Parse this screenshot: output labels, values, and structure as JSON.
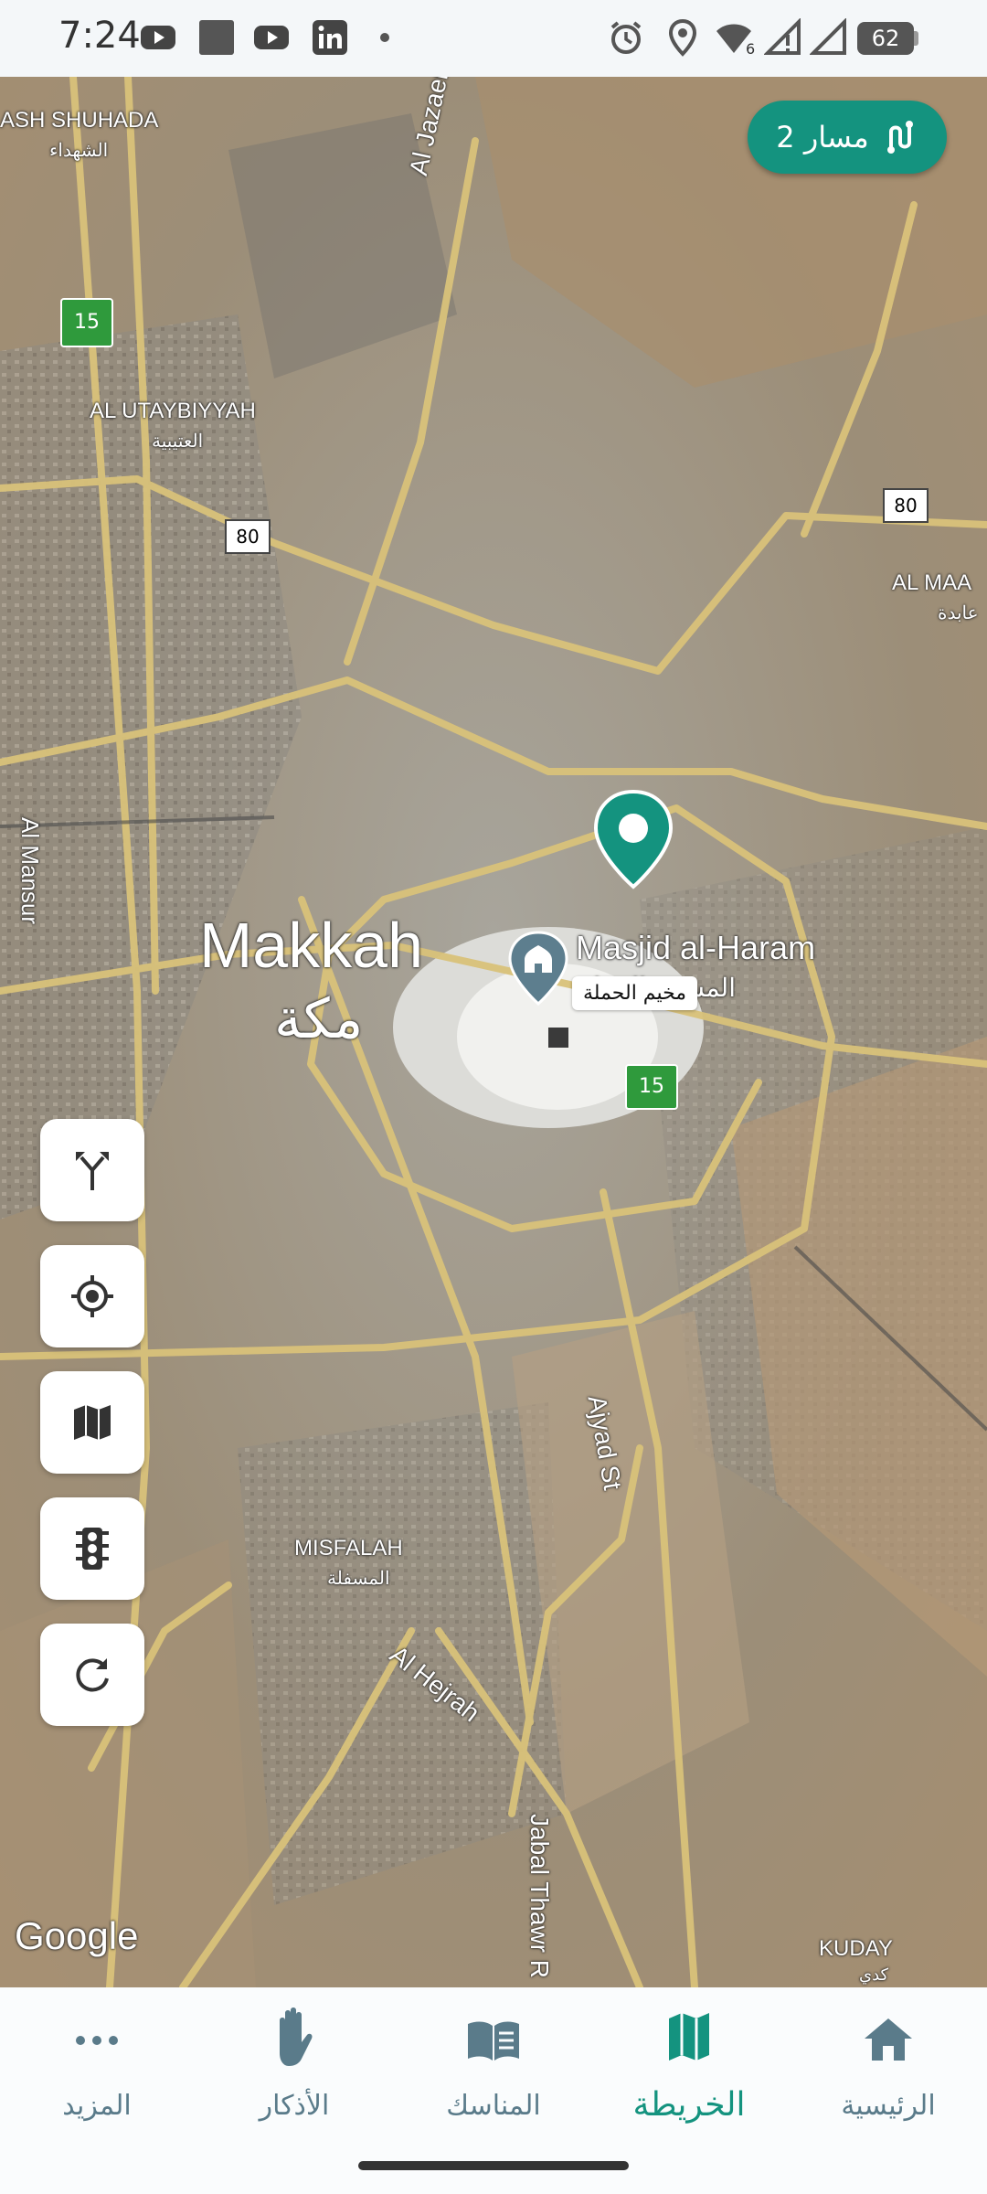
{
  "status_bar": {
    "time": "7:24",
    "battery": "62",
    "signal_badge": "6",
    "left_icons": [
      "youtube-icon",
      "app-square-icon",
      "youtube-icon",
      "linkedin-icon",
      "dot-icon"
    ],
    "right_icons": [
      "alarm-icon",
      "location-icon",
      "wifi-icon",
      "signal-icon",
      "signal-icon",
      "battery-icon"
    ]
  },
  "route_button": {
    "label": "2 مسار",
    "icon": "route-icon"
  },
  "map": {
    "labels": {
      "shuhada_en": "ASH SHUHADA",
      "shuhada_ar": "الشهداء",
      "utaybiyyah_en": "AL UTAYBIYYAH",
      "utaybiyyah_ar": "العتيبية",
      "maabdah_en": "AL MAA",
      "maabdah_ar": "عابدة",
      "makkah_en": "Makkah",
      "makkah_ar": "مكة",
      "haram_en": "Masjid al-Haram",
      "haram_ar": "المسجد الحرام",
      "misfalah_en": "MISFALAH",
      "misfalah_ar": "المسفلة",
      "kuday_en": "KUDAY",
      "kuday_ar": "كدي",
      "al_jazaer": "Al Jazaer",
      "al_mansur": "Al Mansur",
      "ajyad": "Ajyad St",
      "al_hejrah": "Al Hejrah",
      "jabal_thawr": "Jabal Thawr R",
      "google": "Google",
      "road_80_a": "80",
      "road_80_b": "80",
      "road_15_a": "15",
      "road_15_b": "15"
    },
    "pin_label": "مخيم الحملة"
  },
  "map_controls": [
    {
      "name": "directions-button",
      "icon": "fork-arrow-icon"
    },
    {
      "name": "my-location-button",
      "icon": "crosshair-icon"
    },
    {
      "name": "map-layers-button",
      "icon": "map-icon"
    },
    {
      "name": "traffic-button",
      "icon": "traffic-light-icon"
    },
    {
      "name": "refresh-button",
      "icon": "refresh-icon"
    }
  ],
  "bottom_nav": {
    "items": [
      {
        "label": "المزيد",
        "icon": "more-icon"
      },
      {
        "label": "الأذكار",
        "icon": "hand-icon"
      },
      {
        "label": "المناسك",
        "icon": "book-icon"
      },
      {
        "label": "الخريطة",
        "icon": "map-icon",
        "active": true
      },
      {
        "label": "الرئيسية",
        "icon": "home-icon"
      }
    ]
  },
  "colors": {
    "accent": "#14937f",
    "nav_inactive": "#5a7b8a",
    "road": "#d9c27a"
  }
}
